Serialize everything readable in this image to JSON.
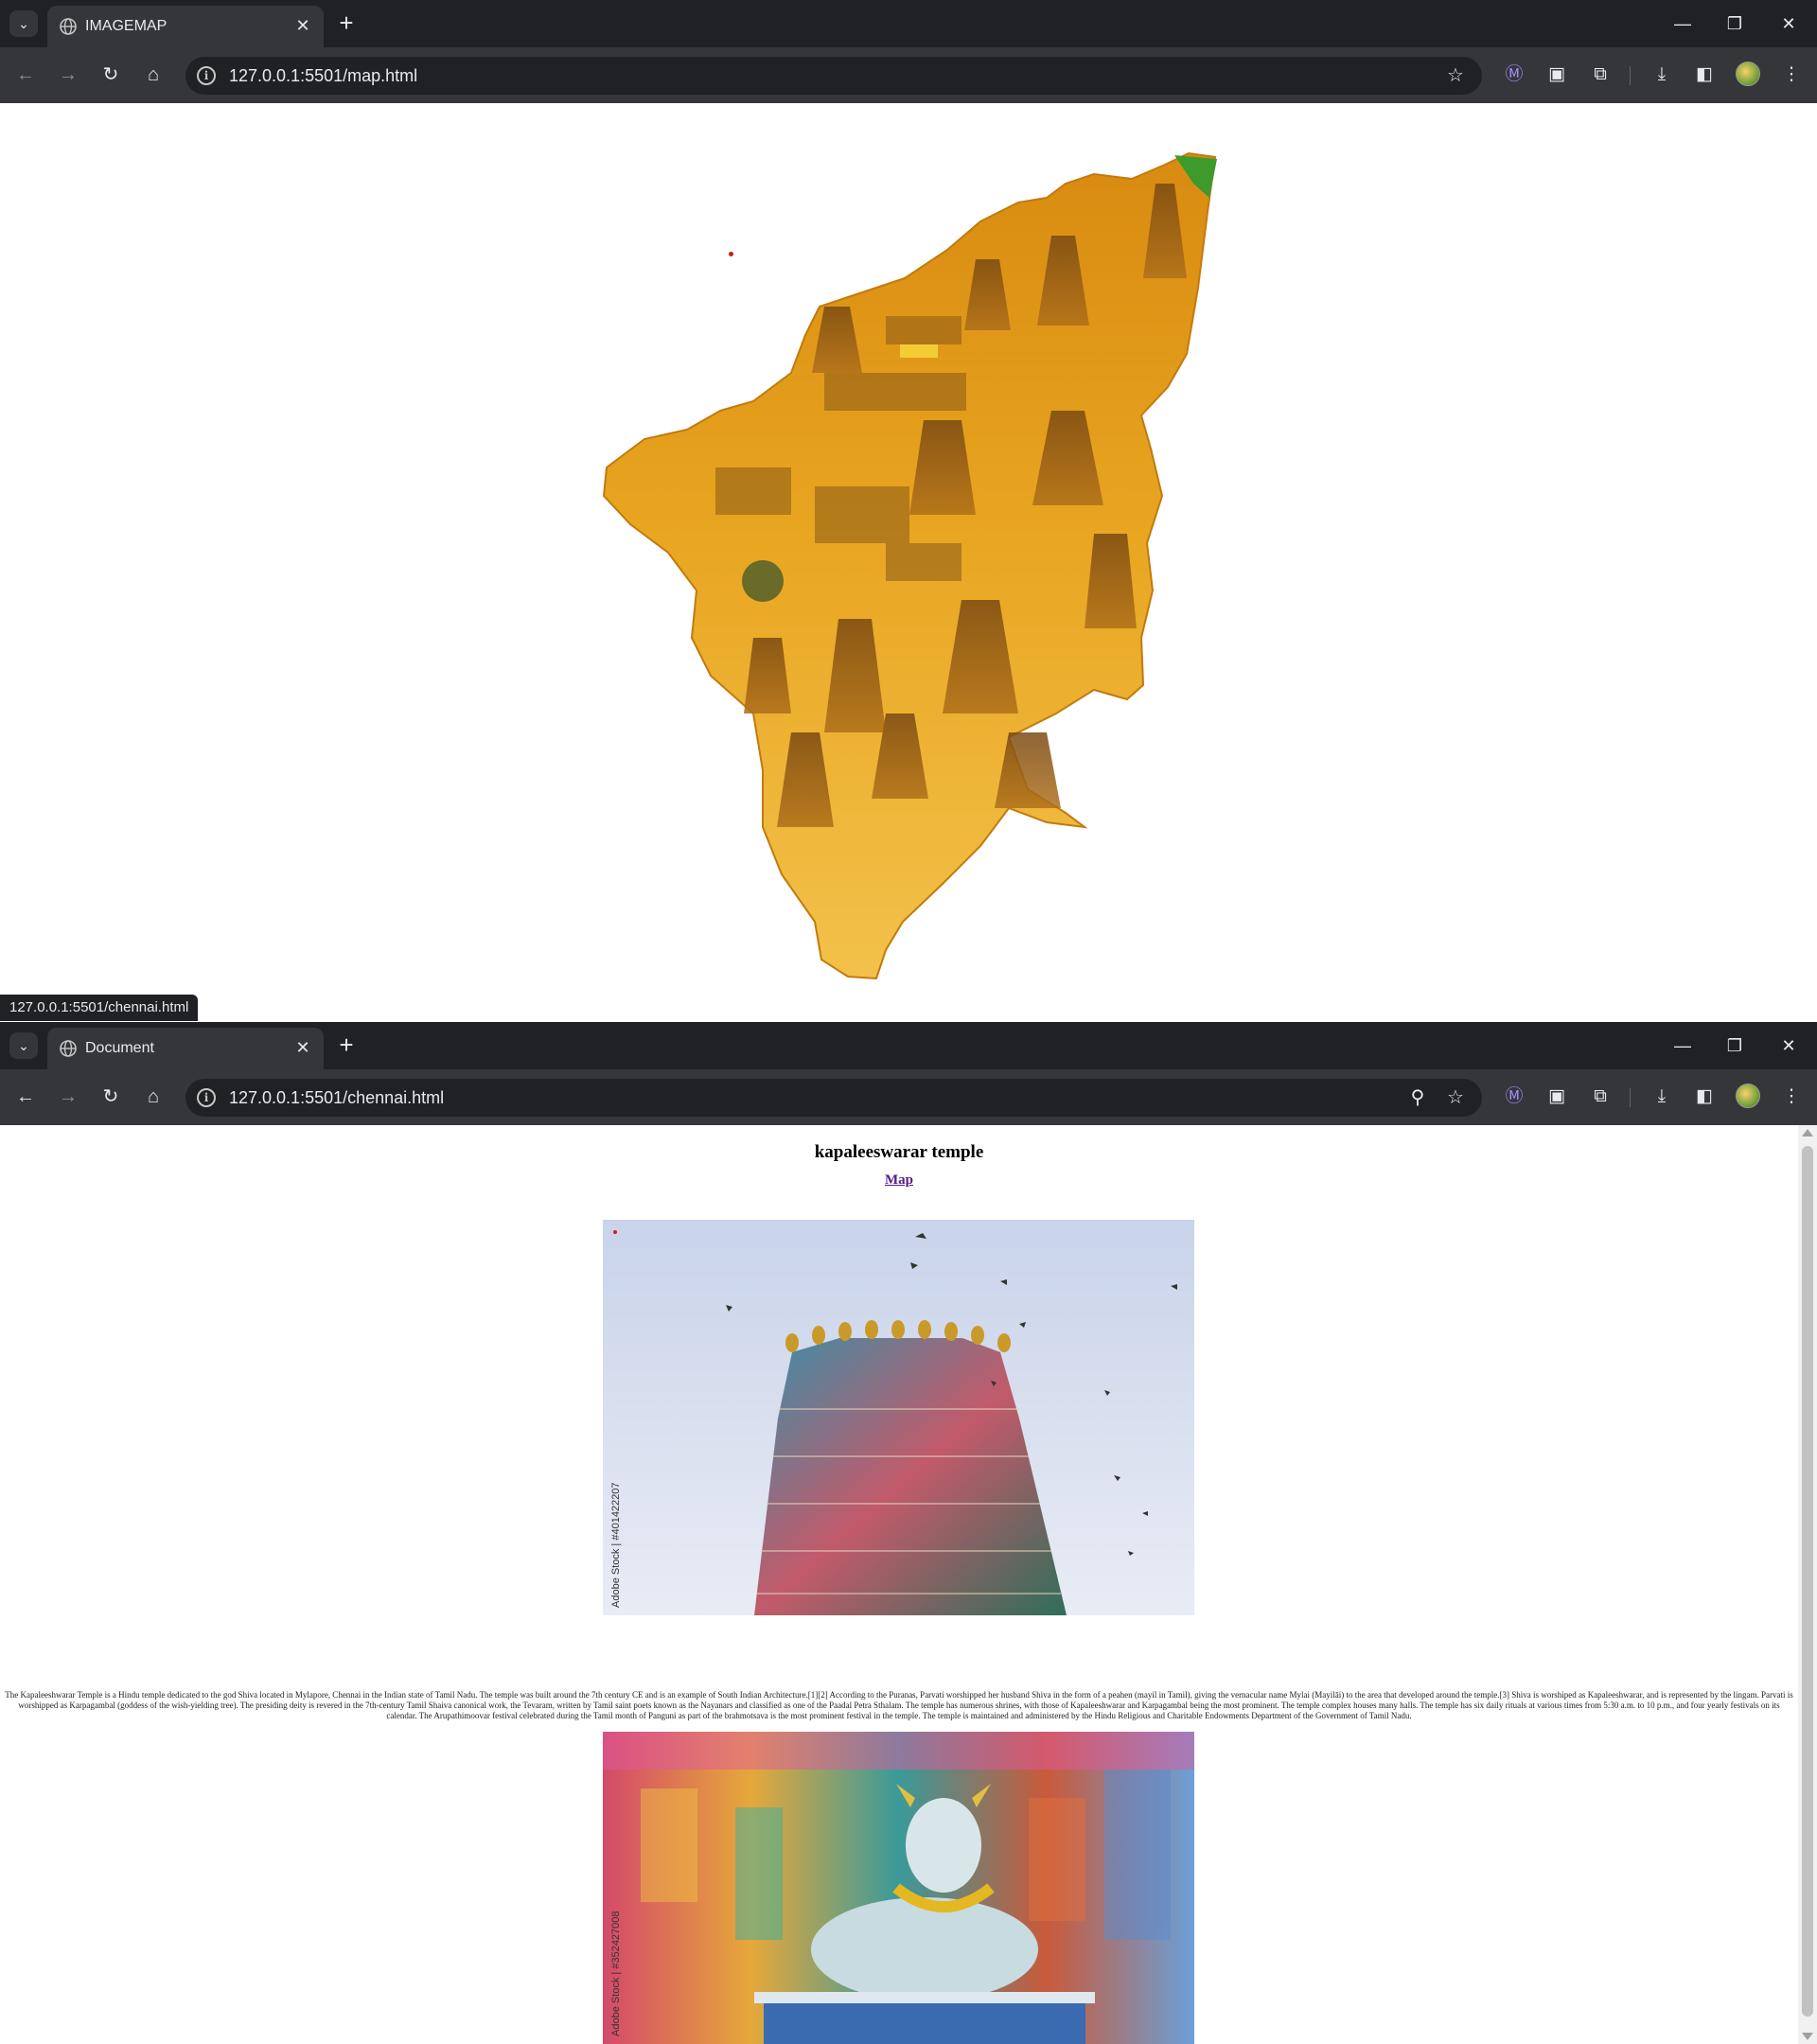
{
  "window1": {
    "tab": {
      "title": "IMAGEMAP",
      "favicon": "globe-icon"
    },
    "url": "127.0.0.1:5501/map.html",
    "status_bar": "127.0.0.1:5501/chennai.html"
  },
  "window2": {
    "tab": {
      "title": "Document",
      "favicon": "globe-icon"
    },
    "url": "127.0.0.1:5501/chennai.html",
    "page": {
      "heading": "kapaleeswarar temple",
      "link_text": "Map",
      "photo1_credit": "Adobe Stock | #401422207",
      "photo2_credit": "Adobe Stock | #352427008",
      "body": "The Kapaleeshwarar Temple is a Hindu temple dedicated to the god Shiva located in Mylapore, Chennai in the Indian state of Tamil Nadu. The temple was built around the 7th century CE and is an example of South Indian Architecture.[1][2] According to the Puranas, Parvati worshipped her husband Shiva in the form of a peahen (mayil in Tamil), giving the vernacular name Mylai (Mayilāi) to the area that developed around the temple.[3] Shiva is worshiped as Kapaleeshwarar, and is represented by the lingam. Parvati is worshipped as Karpagambal (goddess of the wish-yielding tree). The presiding deity is revered in the 7th-century Tamil Shaiva canonical work, the Tevaram, written by Tamil saint poets known as the Nayanars and classified as one of the Paadal Petra Sthalam. The temple has numerous shrines, with those of Kapaleeshwarar and Karpagambal being the most prominent. The temple complex houses many halls. The temple has six daily rituals at various times from 5:30 a.m. to 10 p.m., and four yearly festivals on its calendar. The Arupathimoovar festival celebrated during the Tamil month of Panguni as part of the brahmotsava is the most prominent festival in the temple. The temple is maintained and administered by the Hindu Religious and Charitable Endowments Department of the Government of Tamil Nadu."
    }
  },
  "icons": {
    "tab_search": "chevron-down-icon",
    "close": "close-icon",
    "new_tab": "plus-icon",
    "back": "arrow-left-icon",
    "forward": "arrow-right-icon",
    "reload": "reload-icon",
    "home": "home-icon",
    "bookmark": "star-icon",
    "zoom": "zoom-icon",
    "downloads": "download-icon",
    "extensions": "puzzle-icon",
    "side_panel": "side-panel-icon",
    "menu": "kebab-menu-icon"
  },
  "glyphs": {
    "chevron": "⌄",
    "close": "✕",
    "plus": "+",
    "minimize": "—",
    "restore": "❐",
    "back": "←",
    "forward": "→",
    "reload": "↻",
    "home": "⌂",
    "info": "i",
    "star": "☆",
    "zoom": "⚲",
    "ext1": "Ⓜ",
    "ext2": "▣",
    "puzzle": "⧉",
    "download": "⤓",
    "sidepanel": "◧",
    "menu": "⋮"
  },
  "colors": {
    "chrome_dark": "#202124",
    "chrome_toolbar": "#35363a",
    "link_visited": "#551a8b",
    "map_gold": "#e0a21a"
  }
}
